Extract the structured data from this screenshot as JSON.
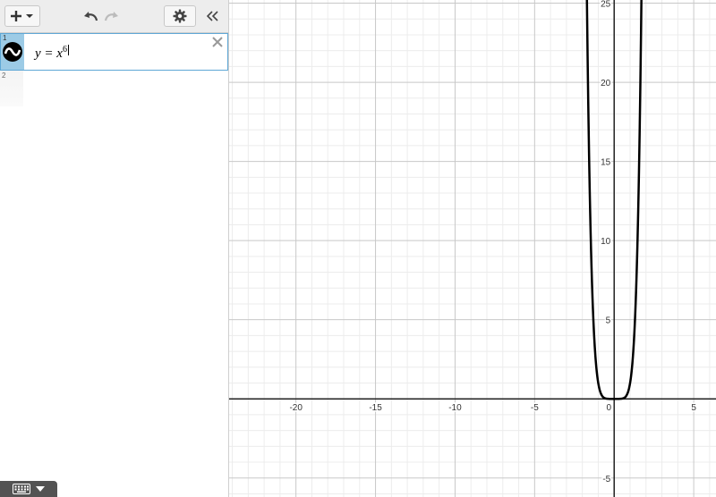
{
  "toolbar": {
    "add_icon": "plus-icon",
    "undo_icon": "undo-icon",
    "redo_icon": "redo-icon",
    "settings_icon": "gear-icon",
    "collapse_icon": "double-chevron-left-icon"
  },
  "expressions": [
    {
      "index": "1",
      "lhs": "y = x",
      "exponent": "6",
      "icon": "wave-icon",
      "color": "#000000"
    },
    {
      "index": "2",
      "lhs": "",
      "exponent": ""
    }
  ],
  "graph": {
    "x_ticks": [
      "-20",
      "-15",
      "-10",
      "-5",
      "0",
      "5"
    ],
    "y_ticks": [
      "25",
      "20",
      "15",
      "10",
      "5",
      "-5"
    ],
    "x_range": [
      -24.2,
      6.4
    ],
    "y_range": [
      -6.2,
      25.2
    ],
    "curve_color": "#000000",
    "grid": true
  },
  "chart_data": {
    "type": "line",
    "title": "",
    "xlabel": "",
    "ylabel": "",
    "xlim": [
      -24.2,
      6.4
    ],
    "ylim": [
      -6.2,
      25.2
    ],
    "x_ticks": [
      -20,
      -15,
      -10,
      -5,
      0,
      5
    ],
    "y_ticks": [
      -5,
      5,
      10,
      15,
      20,
      25
    ],
    "series": [
      {
        "equation": "y = x^6",
        "color": "#000000",
        "x": [
          -1.75,
          -1.6,
          -1.5,
          -1.4,
          -1.2,
          -1.0,
          -0.8,
          -0.5,
          0,
          0.5,
          0.8,
          1.0,
          1.2,
          1.4,
          1.5,
          1.6,
          1.75
        ],
        "y": [
          28.7,
          16.8,
          11.4,
          7.5,
          3.0,
          1.0,
          0.26,
          0.016,
          0,
          0.016,
          0.26,
          1.0,
          3.0,
          7.5,
          11.4,
          16.8,
          28.7
        ]
      }
    ]
  },
  "footer": {
    "keyboard_icon": "keyboard-icon",
    "dropdown_icon": "caret-down-icon"
  }
}
